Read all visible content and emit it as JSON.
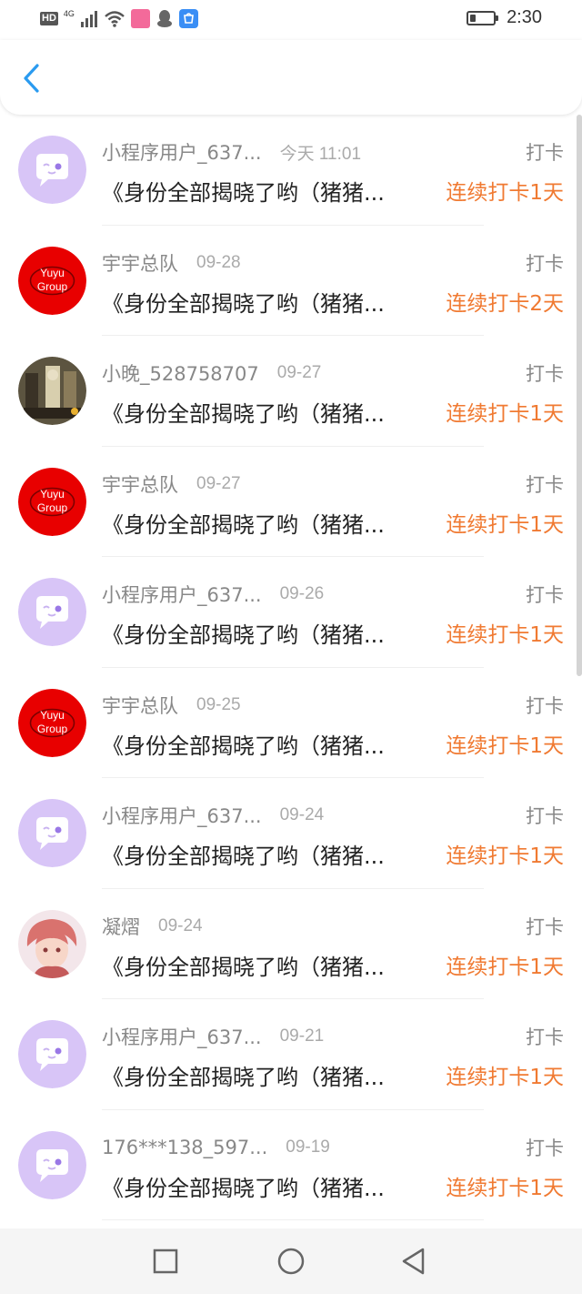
{
  "status_bar": {
    "hd": "HD",
    "network": "4G",
    "time": "2:30",
    "battery_level": 0.25,
    "icons": [
      "signal-icon",
      "wifi-icon",
      "bilibili-icon",
      "qq-icon",
      "appstore-icon"
    ]
  },
  "header": {
    "back_icon": "chevron-left-icon"
  },
  "colors": {
    "accent": "#f07a32",
    "back_blue": "#2a9bf0",
    "avatar_purple": "#d8c5f7",
    "avatar_red": "#e80000"
  },
  "items": [
    {
      "name": "小程序用户_637...",
      "time": "今天 11:01",
      "type": "打卡",
      "title": "《身份全部揭晓了哟（猪猪...",
      "streak": "连续打卡1天",
      "avatar": "chat-bubble-avatar"
    },
    {
      "name": "宇宇总队",
      "time": "09-28",
      "type": "打卡",
      "title": "《身份全部揭晓了哟（猪猪...",
      "streak": "连续打卡2天",
      "avatar": "yuyu-group-avatar",
      "avatar_text": [
        "Yuyu",
        "Group"
      ]
    },
    {
      "name": "小晚_528758707",
      "time": "09-27",
      "type": "打卡",
      "title": "《身份全部揭晓了哟（猪猪...",
      "streak": "连续打卡1天",
      "avatar": "photo-avatar"
    },
    {
      "name": "宇宇总队",
      "time": "09-27",
      "type": "打卡",
      "title": "《身份全部揭晓了哟（猪猪...",
      "streak": "连续打卡1天",
      "avatar": "yuyu-group-avatar",
      "avatar_text": [
        "Yuyu",
        "Group"
      ]
    },
    {
      "name": "小程序用户_637...",
      "time": "09-26",
      "type": "打卡",
      "title": "《身份全部揭晓了哟（猪猪...",
      "streak": "连续打卡1天",
      "avatar": "chat-bubble-avatar"
    },
    {
      "name": "宇宇总队",
      "time": "09-25",
      "type": "打卡",
      "title": "《身份全部揭晓了哟（猪猪...",
      "streak": "连续打卡1天",
      "avatar": "yuyu-group-avatar",
      "avatar_text": [
        "Yuyu",
        "Group"
      ]
    },
    {
      "name": "小程序用户_637...",
      "time": "09-24",
      "type": "打卡",
      "title": "《身份全部揭晓了哟（猪猪...",
      "streak": "连续打卡1天",
      "avatar": "chat-bubble-avatar"
    },
    {
      "name": "凝熠",
      "time": "09-24",
      "type": "打卡",
      "title": "《身份全部揭晓了哟（猪猪...",
      "streak": "连续打卡1天",
      "avatar": "anime-avatar"
    },
    {
      "name": "小程序用户_637...",
      "time": "09-21",
      "type": "打卡",
      "title": "《身份全部揭晓了哟（猪猪...",
      "streak": "连续打卡1天",
      "avatar": "chat-bubble-avatar"
    },
    {
      "name": "176***138_597...",
      "time": "09-19",
      "type": "打卡",
      "title": "《身份全部揭晓了哟（猪猪...",
      "streak": "连续打卡1天",
      "avatar": "chat-bubble-avatar"
    }
  ],
  "bottom_nav": {
    "icons": [
      "recent-apps-icon",
      "home-icon",
      "back-icon"
    ]
  }
}
